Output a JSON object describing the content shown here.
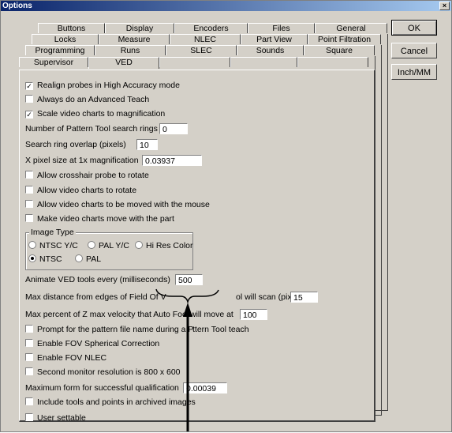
{
  "window": {
    "title": "Options"
  },
  "tabs": {
    "row1": [
      "Buttons",
      "Display",
      "Encoders",
      "Files",
      "General"
    ],
    "row2": [
      "Locks",
      "Measure",
      "NLEC",
      "Part View",
      "Point Filtration"
    ],
    "row3": [
      "Programming",
      "Runs",
      "SLEC",
      "Sounds",
      "Square"
    ],
    "row4": [
      "Supervisor",
      "VED",
      "",
      "",
      ""
    ]
  },
  "buttons": {
    "ok": "OK",
    "cancel": "Cancel",
    "inch_mm": "Inch/MM"
  },
  "ved": {
    "realign": {
      "label": "Realign probes in High Accuracy mode",
      "checked": true
    },
    "advanced_teach": {
      "label": "Always do an Advanced Teach",
      "checked": false
    },
    "scale_video": {
      "label": "Scale video charts to magnification",
      "checked": true
    },
    "search_rings": {
      "label": "Number of Pattern Tool search rings",
      "value": "0"
    },
    "ring_overlap": {
      "label": "Search ring overlap (pixels)",
      "value": "10"
    },
    "pixel_size": {
      "label": "X pixel size at 1x magnification",
      "value": "0.03937"
    },
    "crosshair_rotate": {
      "label": "Allow crosshair probe to rotate",
      "checked": false
    },
    "video_rotate": {
      "label": "Allow video charts to rotate",
      "checked": false
    },
    "video_move_mouse": {
      "label": "Allow video charts to be moved with the mouse",
      "checked": false
    },
    "video_move_part": {
      "label": "Make video charts move with the part",
      "checked": false
    },
    "image_type": {
      "label": "Image Type",
      "options": [
        "NTSC Y/C",
        "PAL Y/C",
        "Hi Res Color",
        "NTSC",
        "PAL"
      ],
      "selected": "NTSC"
    },
    "animate": {
      "label": "Animate VED tools every (milliseconds)",
      "value": "500"
    },
    "max_distance": {
      "label": "Max distance from edges of Field Of View that Auto Focus tool will scan (pixels)",
      "label_left": "Max distance from edges of Field Of V",
      "label_right": "ol will scan (pixels)",
      "value": "15"
    },
    "max_percent_z": {
      "label_left": "Max percent of Z max velocity that Auto Focu",
      "label_right": "will move at",
      "value": "100"
    },
    "prompt_pattern": {
      "label_left": "Prompt for the pattern file name during a P",
      "label_right": "ttern Tool teach",
      "checked": false
    },
    "fov_spherical": {
      "label": "Enable FOV Spherical Correction",
      "checked": false
    },
    "fov_nlec": {
      "label": "Enable FOV NLEC",
      "checked": false
    },
    "second_monitor": {
      "label": "Second monitor resolution is 800 x 600",
      "checked": false
    },
    "max_form": {
      "label": "Maximum form for successful qualification",
      "value": "0.00039"
    },
    "include_tools": {
      "label": "Include tools and points in archived images",
      "checked": false
    },
    "user_settable": {
      "label": "User settable",
      "checked": false
    }
  },
  "annotation": {
    "brace": "bracket under Max distance text field",
    "arrow": "upward arrow pointing to the brace"
  }
}
